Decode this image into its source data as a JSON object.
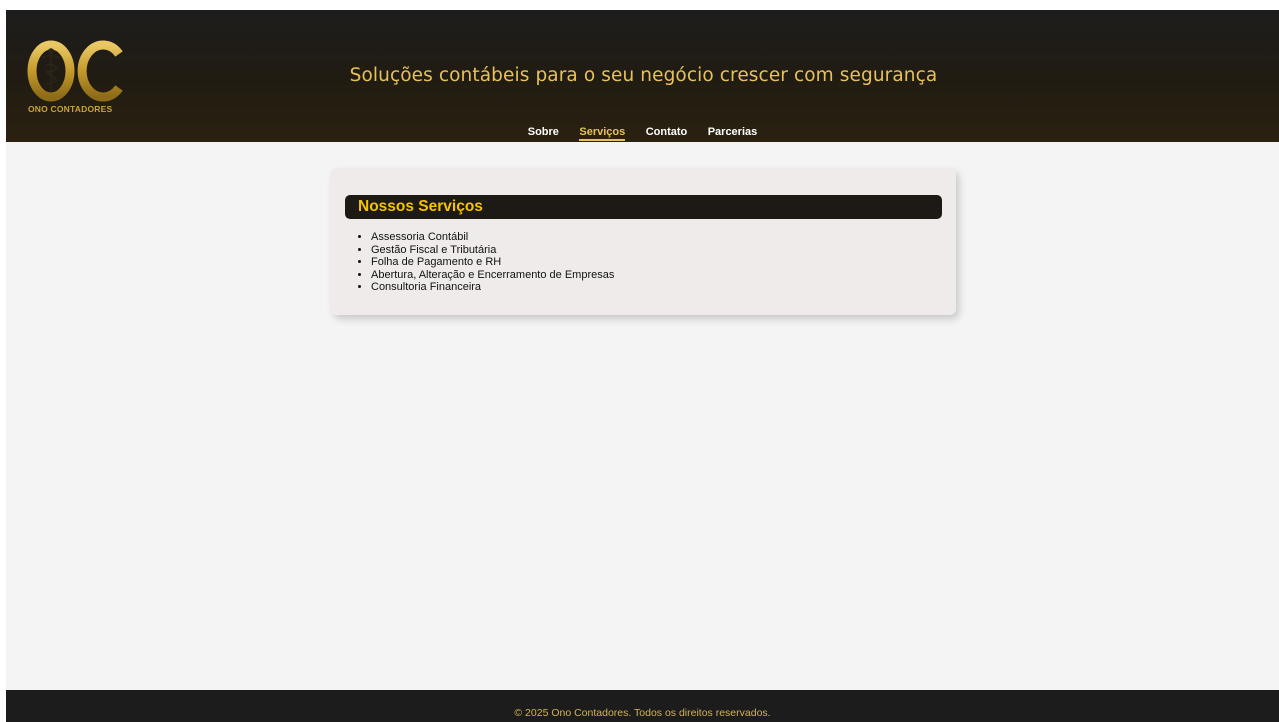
{
  "brand": {
    "logo_monogram": "OC",
    "logo_caption": "ONO CONTADORES"
  },
  "header": {
    "tagline": "Soluções contábeis para o seu negócio crescer com segurança"
  },
  "nav": {
    "items": [
      {
        "label": "Sobre",
        "active": false
      },
      {
        "label": "Serviços",
        "active": true
      },
      {
        "label": "Contato",
        "active": false
      },
      {
        "label": "Parcerias",
        "active": false
      }
    ]
  },
  "services": {
    "title": "Nossos Serviços",
    "items": [
      "Assessoria Contábil",
      "Gestão Fiscal e Tributária",
      "Folha de Pagamento e RH",
      "Abertura, Alteração e Encerramento de Empresas",
      "Consultoria Financeira"
    ]
  },
  "footer": {
    "text": "© 2025 Ono Contadores. Todos os direitos reservados."
  },
  "colors": {
    "header_bg": "#1d1d1d",
    "accent_gold": "#e7c15a",
    "title_yellow": "#f5c400",
    "card_bg": "#efebeb",
    "page_bg": "#f4f4f4"
  },
  "icons": {
    "logo_emblem": "caduceus-icon"
  }
}
